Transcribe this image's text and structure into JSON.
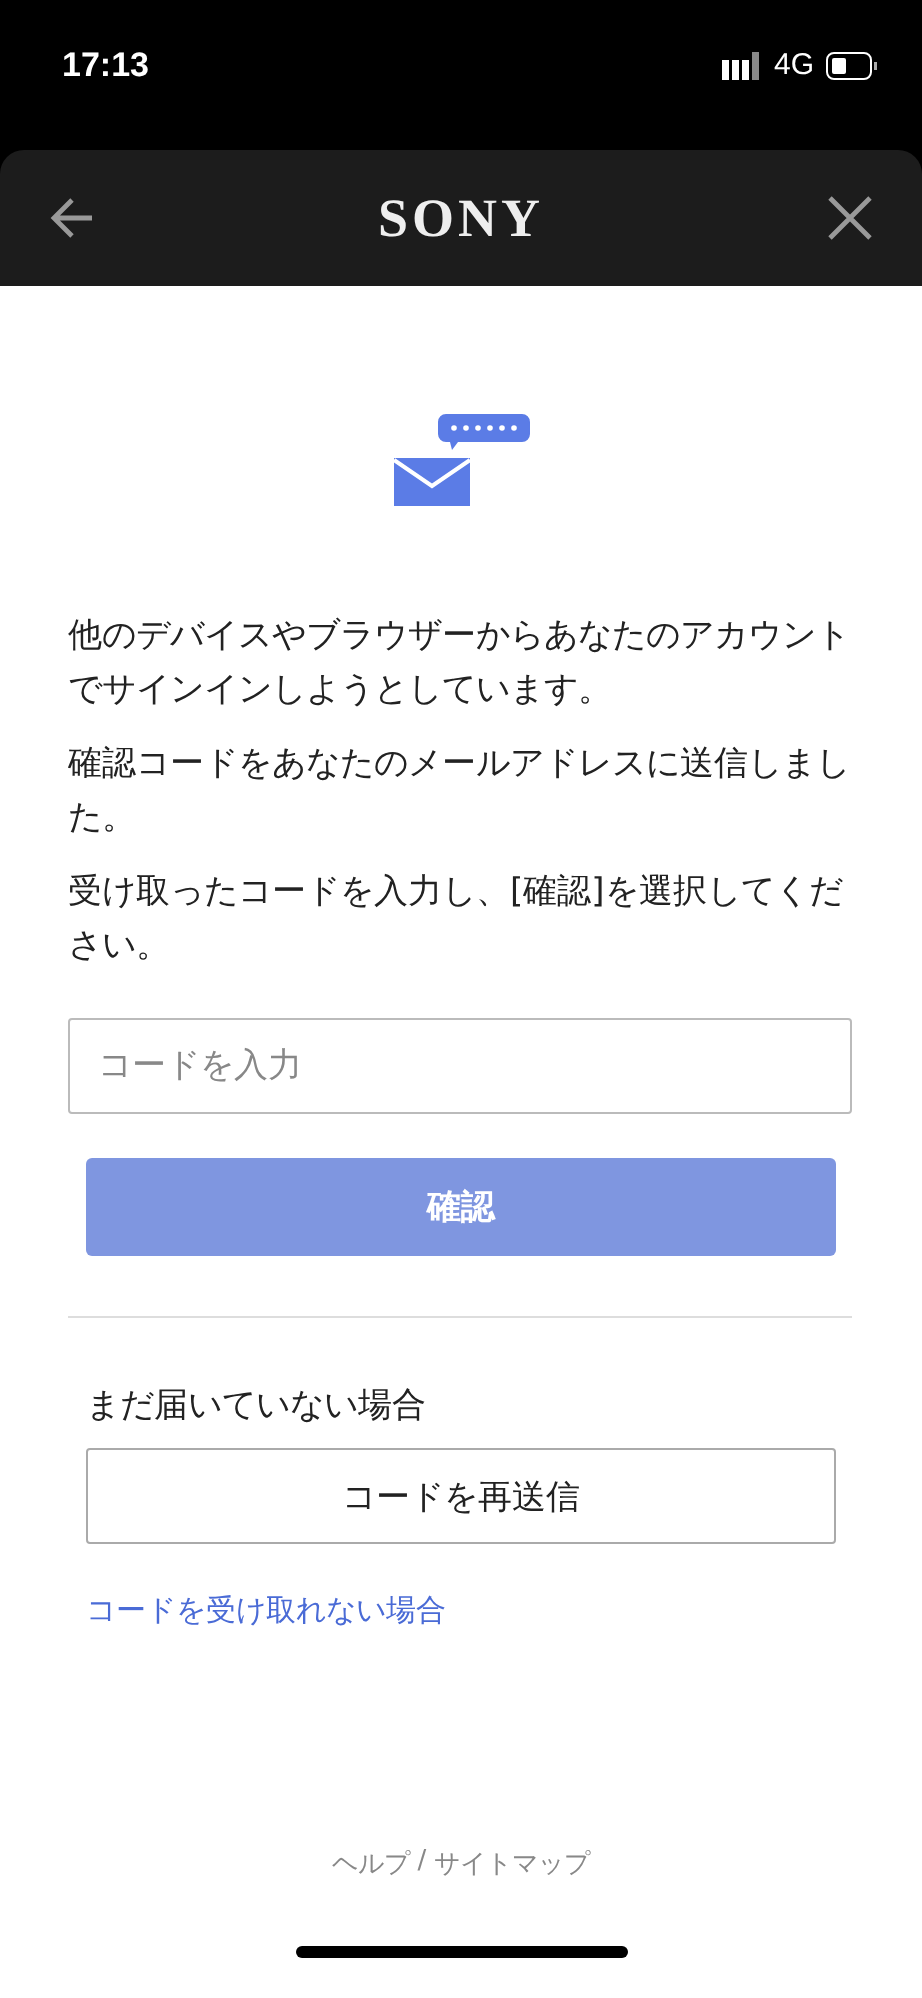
{
  "status_bar": {
    "time": "17:13",
    "network": "4G"
  },
  "header": {
    "logo": "SONY"
  },
  "paragraphs": [
    "他のデバイスやブラウザーからあなたのアカウントでサインインしようとしています。",
    "確認コードをあなたのメールアドレスに送信しました。",
    "受け取ったコードを入力し、[確認]を選択してください。"
  ],
  "code_field": {
    "placeholder": "コードを入力"
  },
  "confirm_button": {
    "label": "確認",
    "disabled": true
  },
  "resend": {
    "prompt": "まだ届いていない場合",
    "button": "コードを再送信"
  },
  "help_link": "コードを受け取れない場合",
  "footer": {
    "links": [
      "ヘルプ",
      "サイトマップ"
    ],
    "separator": "/"
  }
}
